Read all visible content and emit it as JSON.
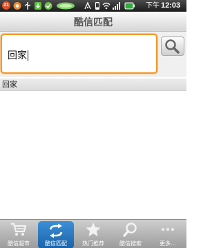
{
  "status_bar": {
    "notification_count": "21",
    "time_prefix": "下午",
    "time": "12:03"
  },
  "title_bar": {
    "title": "酷信匹配"
  },
  "search": {
    "value": "回家"
  },
  "results": [
    {
      "text": "回家"
    }
  ],
  "tabs": [
    {
      "label": "酷信超市",
      "icon": "cart-icon"
    },
    {
      "label": "酷信匹配",
      "icon": "sync-arrows-icon",
      "selected": true
    },
    {
      "label": "热门推荐",
      "icon": "star-icon"
    },
    {
      "label": "酷信搜索",
      "icon": "magnifier-icon"
    },
    {
      "label": "更多...",
      "icon": "more-dots-icon"
    }
  ],
  "colors": {
    "accent": "#f39a2b",
    "selected_tab": "#2a7bc6"
  }
}
